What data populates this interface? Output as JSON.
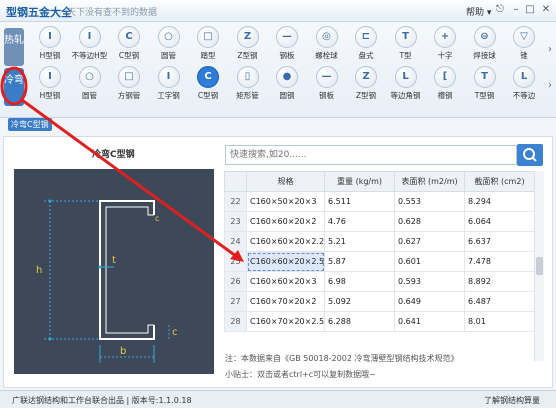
{
  "window": {
    "title": "型钢五金大全",
    "slogan": "天下没有查不到的数据",
    "help_label": "帮助",
    "help_arrow": "▾"
  },
  "ribbon": {
    "tab_a": "热轧",
    "tab_b": "冷弯",
    "row1": [
      {
        "label": "H型钢",
        "glyph": "I",
        "icon": "h-beam-icon"
      },
      {
        "label": "不等边H型",
        "glyph": "I",
        "icon": "unequal-h-beam-icon"
      },
      {
        "label": "C型钢",
        "glyph": "C",
        "icon": "c-section-icon"
      },
      {
        "label": "圆管",
        "glyph": "○",
        "icon": "round-pipe-icon"
      },
      {
        "label": "踏型",
        "glyph": "□",
        "icon": "tread-section-icon"
      },
      {
        "label": "Z型钢",
        "glyph": "Z",
        "icon": "z-section-icon"
      },
      {
        "label": "钢板",
        "glyph": "—",
        "icon": "steel-plate-icon"
      },
      {
        "label": "螺栓球",
        "glyph": "◎",
        "icon": "bolt-ball-icon"
      },
      {
        "label": "盘式",
        "glyph": "⊏",
        "icon": "disc-type-icon"
      },
      {
        "label": "T型",
        "glyph": "T",
        "icon": "t-section-icon"
      },
      {
        "label": "十字",
        "glyph": "+",
        "icon": "cross-section-icon"
      },
      {
        "label": "焊接球",
        "glyph": "⊖",
        "icon": "welded-ball-icon"
      },
      {
        "label": "锥",
        "glyph": "▽",
        "icon": "cone-icon"
      }
    ],
    "row2": [
      {
        "label": "H型钢",
        "glyph": "I",
        "icon": "h-beam-icon"
      },
      {
        "label": "圆管",
        "glyph": "○",
        "icon": "round-pipe-icon"
      },
      {
        "label": "方钢管",
        "glyph": "□",
        "icon": "square-pipe-icon"
      },
      {
        "label": "工字钢",
        "glyph": "I",
        "icon": "i-beam-icon"
      },
      {
        "label": "C型钢",
        "glyph": "C",
        "icon": "c-section-icon",
        "selected": true
      },
      {
        "label": "矩形管",
        "glyph": "▯",
        "icon": "rect-pipe-icon"
      },
      {
        "label": "圆钢",
        "glyph": "●",
        "icon": "round-bar-icon"
      },
      {
        "label": "钢板",
        "glyph": "—",
        "icon": "steel-plate-icon"
      },
      {
        "label": "Z型钢",
        "glyph": "Z",
        "icon": "z-section-icon"
      },
      {
        "label": "等边角钢",
        "glyph": "L",
        "icon": "equal-angle-icon"
      },
      {
        "label": "槽钢",
        "glyph": "[",
        "icon": "channel-icon"
      },
      {
        "label": "T型钢",
        "glyph": "T",
        "icon": "t-section-icon"
      },
      {
        "label": "不等边",
        "glyph": "L",
        "icon": "unequal-angle-icon"
      }
    ],
    "breadcrumb": "冷弯C型钢"
  },
  "main": {
    "section_title": "冷弯C型钢",
    "search_placeholder": "快速搜索,如20......",
    "diagram_labels": {
      "h": "h",
      "t": "t",
      "b": "b",
      "c": "c"
    },
    "columns": [
      "",
      "规格",
      "重量 (kg/m)",
      "表面积 (m2/m)",
      "截面积 (cm2)"
    ],
    "rows": [
      {
        "idx": "22",
        "spec": "C160×50×20×3",
        "weight": "6.511",
        "surface": "0.553",
        "area": "8.294"
      },
      {
        "idx": "23",
        "spec": "C160×60×20×2",
        "weight": "4.76",
        "surface": "0.628",
        "area": "6.064"
      },
      {
        "idx": "24",
        "spec": "C160×60×20×2.2",
        "weight": "5.21",
        "surface": "0.627",
        "area": "6.637"
      },
      {
        "idx": "25",
        "spec": "C160×60×20×2.5",
        "weight": "5.87",
        "surface": "0.601",
        "area": "7.478",
        "selected": true
      },
      {
        "idx": "26",
        "spec": "C160×60×20×3",
        "weight": "6.98",
        "surface": "0.593",
        "area": "8.892"
      },
      {
        "idx": "27",
        "spec": "C160×70×20×2",
        "weight": "5.092",
        "surface": "0.649",
        "area": "6.487"
      },
      {
        "idx": "28",
        "spec": "C160×70×20×2.5",
        "weight": "6.288",
        "surface": "0.641",
        "area": "8.01"
      }
    ],
    "note": "注：本数据来自《GB 50018-2002 冷弯薄壁型钢结构技术规范》",
    "tip": "小贴士：双击或者ctrl+c可以复制数据哦~"
  },
  "status": {
    "left": "广联达钢结构和工作台联合出品 | 版本号:1.1.0.18",
    "right": "了解钢结构算量"
  },
  "colors": {
    "accent": "#3b7cc6",
    "annotation": "#e02020",
    "diagram_bg": "#3d4858"
  }
}
